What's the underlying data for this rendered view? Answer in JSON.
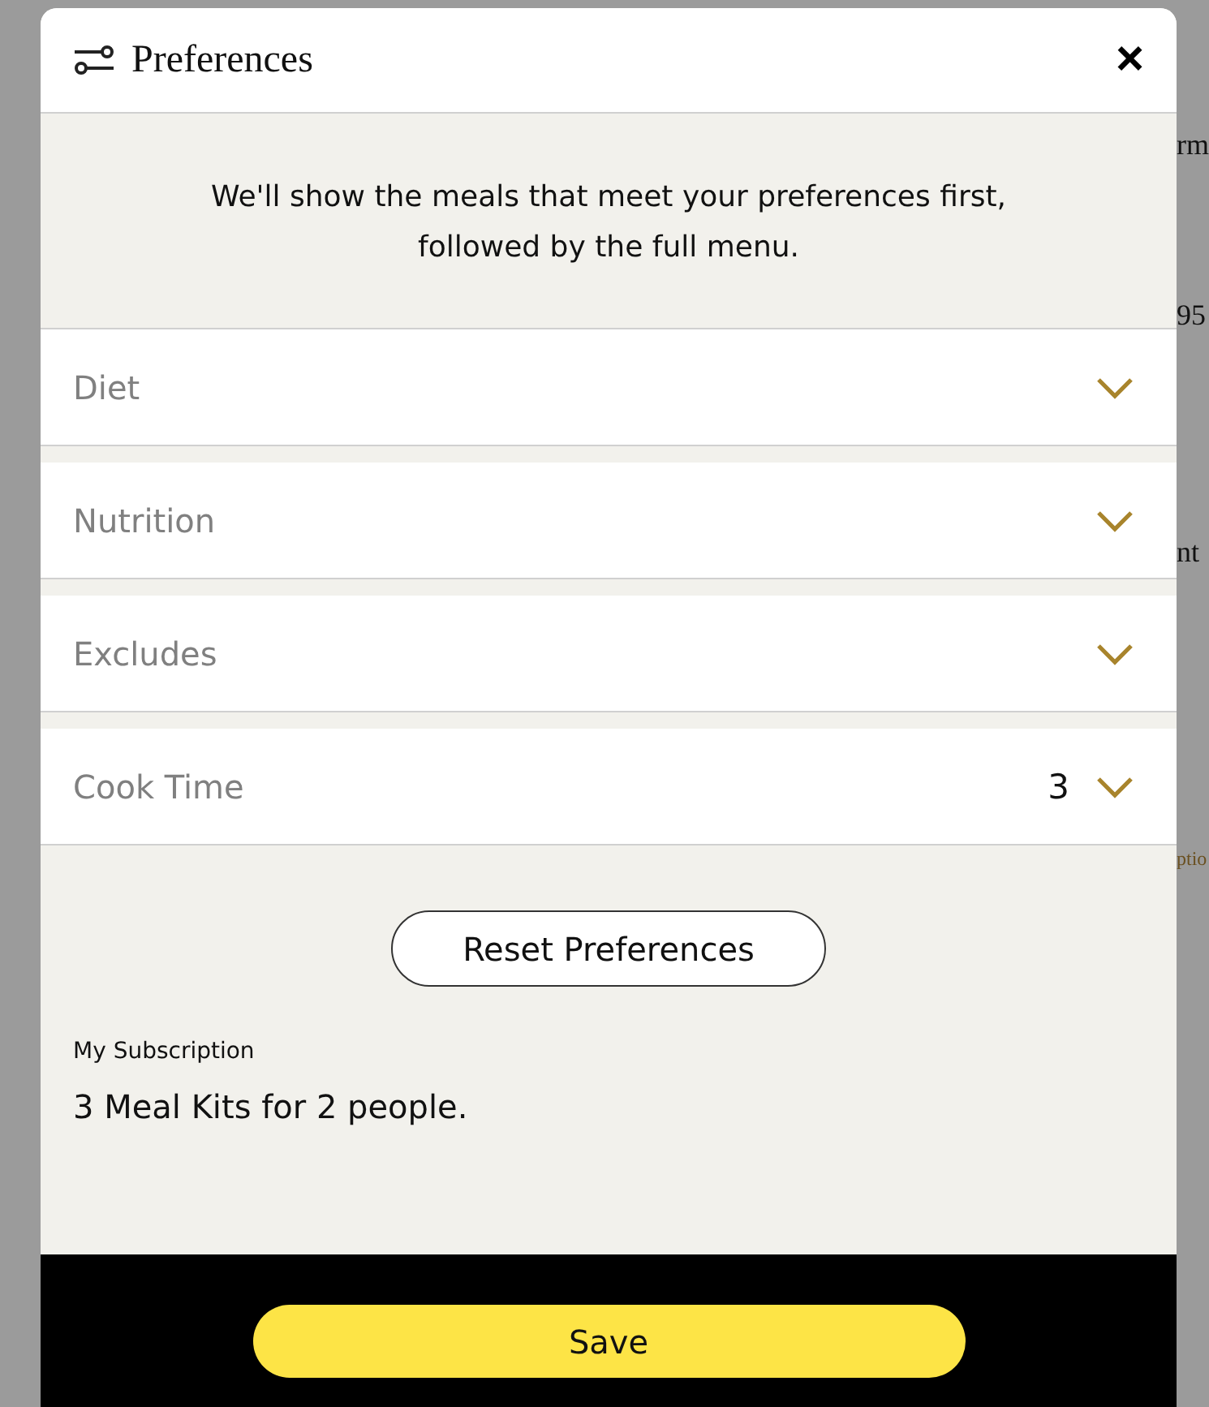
{
  "background_texts": [
    "rm",
    "95",
    "nt",
    "ptio"
  ],
  "dialog": {
    "title": "Preferences",
    "close": "×"
  },
  "intro": "We'll show the meals that meet your preferences first, followed by the full menu.",
  "sections": [
    {
      "label": "Diet",
      "expanded": false
    },
    {
      "label": "Nutrition",
      "expanded": false
    },
    {
      "label": "Excludes",
      "expanded": false
    },
    {
      "label": "Cook Time",
      "value": "3",
      "expanded": false
    }
  ],
  "reset_button": "Reset Preferences",
  "subscription": {
    "label": "My Subscription",
    "value": "3 Meal Kits for 2 people."
  },
  "save_button": "Save"
}
